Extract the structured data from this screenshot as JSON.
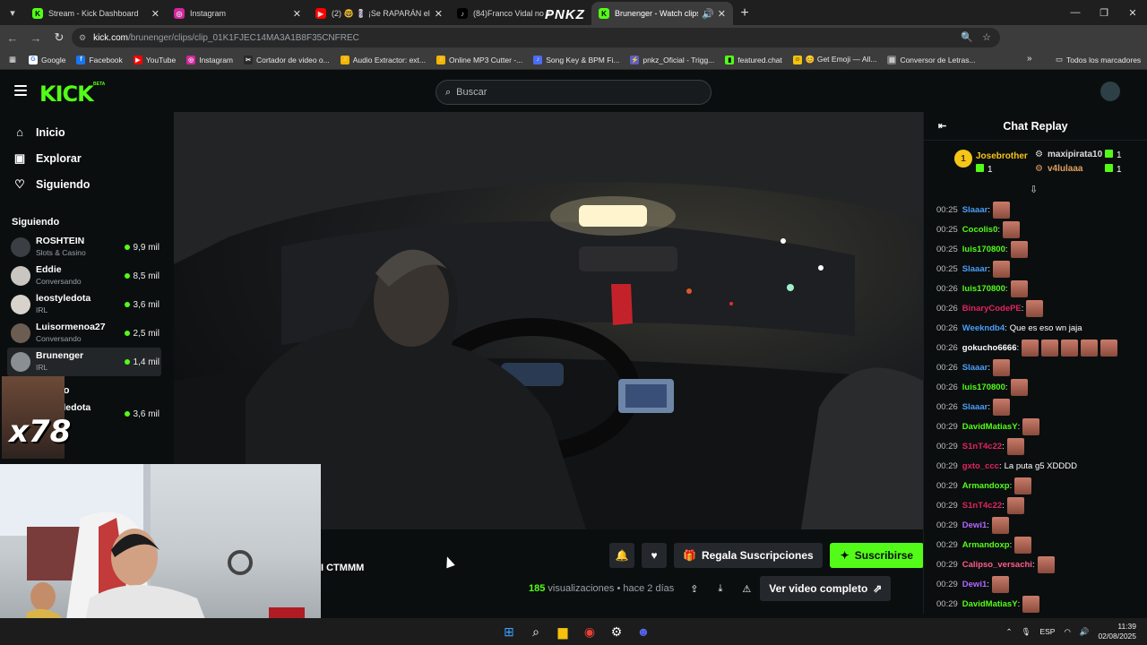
{
  "browser": {
    "tabs": [
      {
        "title": "Stream - Kick Dashboard",
        "icon": "kick-icon"
      },
      {
        "title": "Instagram",
        "icon": "instagram-icon"
      },
      {
        "title": "(2) 🤓 💈 ¡Se RAPARÁN el cabe",
        "icon": "youtube-icon"
      },
      {
        "title": "(84)Franco Vidal no v",
        "icon": "tiktok-icon"
      },
      {
        "title": "Brunenger - Watch clips on",
        "icon": "kick-icon"
      }
    ],
    "url_host": "kick.com",
    "url_path": "/brunenger/clips/clip_01K1FJEC14MA3A1B8F35CNFREC",
    "bookmarks": [
      "Google",
      "Facebook",
      "YouTube",
      "Instagram",
      "Cortador de video o...",
      "Audio Extractor: ext...",
      "Online MP3 Cutter -...",
      "Song Key & BPM Fi...",
      "pnkz_Oficial - Trigg...",
      "featured.chat",
      "😊 Get Emoji — All...",
      "Conversor de Letras..."
    ],
    "bookmarks_all": "Todos los marcadores",
    "overlay_logo": "PNKZ"
  },
  "header": {
    "logo": "KICK",
    "beta": "BETA",
    "search_placeholder": "Buscar"
  },
  "sidebar": {
    "nav": [
      "Inicio",
      "Explorar",
      "Siguiendo"
    ],
    "following_title": "Siguiendo",
    "channels": [
      {
        "name": "ROSHTEIN",
        "category": "Slots & Casino",
        "viewers": "9,9 mil"
      },
      {
        "name": "Eddie",
        "category": "Conversando",
        "viewers": "8,5 mil"
      },
      {
        "name": "leostyledota",
        "category": "IRL",
        "viewers": "3,6 mil"
      },
      {
        "name": "Luisormenoa27",
        "category": "Conversando",
        "viewers": "2,5 mil"
      },
      {
        "name": "Brunenger",
        "category": "IRL",
        "viewers": "1,4 mil"
      }
    ],
    "second_title_partial": "do",
    "second_channel": {
      "name": "leostyledota",
      "category": "IRL",
      "viewers": "3,6 mil"
    }
  },
  "overlay": {
    "multiplier": "x78"
  },
  "clip": {
    "title_partial": "I CTMMM",
    "gift_label": "Regala Suscripciones",
    "subscribe_label": "Suscribirse",
    "views": "185",
    "views_label": "visualizaciones",
    "separator": "•",
    "age": "hace 2 días",
    "full_video_label": "Ver video completo"
  },
  "chat": {
    "title": "Chat Replay",
    "leaders": [
      {
        "rank": "1",
        "name": "Josebrother",
        "count": "1"
      },
      {
        "name": "maxipirata10",
        "count": "1"
      },
      {
        "name": "v4lulaaa",
        "count": "1"
      }
    ],
    "messages": [
      {
        "time": "00:25",
        "user": "Slaaar",
        "color": "#4b9ef8",
        "text": "",
        "emotes": 1
      },
      {
        "time": "00:25",
        "user": "Cocolis0",
        "color": "#53fc18",
        "text": "",
        "emotes": 1
      },
      {
        "time": "00:25",
        "user": "luis170800",
        "color": "#53fc18",
        "text": "",
        "emotes": 1
      },
      {
        "time": "00:25",
        "user": "Slaaar",
        "color": "#4b9ef8",
        "text": "",
        "emotes": 1
      },
      {
        "time": "00:26",
        "user": "luis170800",
        "color": "#53fc18",
        "text": "",
        "emotes": 1
      },
      {
        "time": "00:26",
        "user": "BinaryCodePE",
        "color": "#e0245e",
        "text": "",
        "emotes": 1
      },
      {
        "time": "00:26",
        "user": "Weekndb4",
        "color": "#4b9ef8",
        "text": "Que es eso wn jaja",
        "emotes": 0
      },
      {
        "time": "00:26",
        "user": "gokucho6666",
        "color": "#ffffff",
        "text": "",
        "emotes": 5
      },
      {
        "time": "00:26",
        "user": "Slaaar",
        "color": "#4b9ef8",
        "text": "",
        "emotes": 1
      },
      {
        "time": "00:26",
        "user": "luis170800",
        "color": "#53fc18",
        "text": "",
        "emotes": 1
      },
      {
        "time": "00:26",
        "user": "Slaaar",
        "color": "#4b9ef8",
        "text": "",
        "emotes": 1
      },
      {
        "time": "00:29",
        "user": "DavidMatiasY",
        "color": "#53fc18",
        "text": "",
        "emotes": 1
      },
      {
        "time": "00:29",
        "user": "S1nT4c22",
        "color": "#e0245e",
        "text": "",
        "emotes": 1
      },
      {
        "time": "00:29",
        "user": "gxto_ccc",
        "color": "#e0245e",
        "text": "La puta g5 XDDDD",
        "emotes": 0
      },
      {
        "time": "00:29",
        "user": "Armandoxp",
        "color": "#53fc18",
        "text": "",
        "emotes": 1
      },
      {
        "time": "00:29",
        "user": "S1nT4c22",
        "color": "#e0245e",
        "text": "",
        "emotes": 1
      },
      {
        "time": "00:29",
        "user": "Dewi1",
        "color": "#b266ff",
        "text": "",
        "emotes": 1
      },
      {
        "time": "00:29",
        "user": "Armandoxp",
        "color": "#53fc18",
        "text": "",
        "emotes": 1
      },
      {
        "time": "00:29",
        "user": "Calipso_versachi",
        "color": "#ff5c8a",
        "text": "",
        "emotes": 1
      },
      {
        "time": "00:29",
        "user": "Dewi1",
        "color": "#b266ff",
        "text": "",
        "emotes": 1
      },
      {
        "time": "00:29",
        "user": "DavidMatiasY",
        "color": "#53fc18",
        "text": "",
        "emotes": 1
      }
    ]
  },
  "taskbar": {
    "lang": "ESP",
    "time": "11:39",
    "date": "02/08/2025"
  },
  "colors": {
    "kick_green": "#53fc18",
    "background": "#0b0e0f"
  }
}
